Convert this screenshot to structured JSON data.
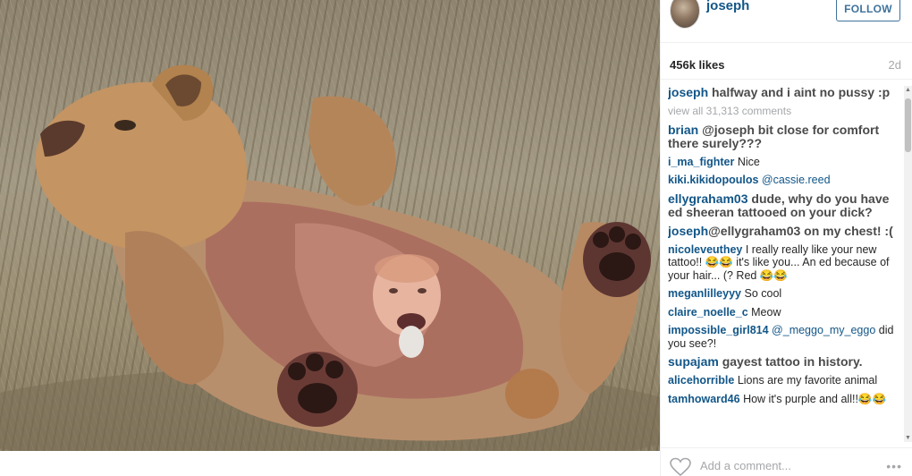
{
  "post": {
    "username": "joseph",
    "follow_label": "FOLLOW",
    "likes": "456k likes",
    "time_ago": "2d"
  },
  "comments": {
    "caption": {
      "user": "joseph",
      "text": "halfway and i aint no pussy :p"
    },
    "view_all": "view all 31,313 comments",
    "items": [
      {
        "user": "brian",
        "text": "@joseph bit close for comfort there surely???"
      },
      {
        "user": "i_ma_fighter",
        "text": "Nice"
      },
      {
        "user": "kiki.kikidopoulos",
        "mention": "@cassie.reed"
      },
      {
        "user": "ellygraham03",
        "text": "dude, why do you have ed sheeran tattooed on your dick?"
      },
      {
        "user": "joseph",
        "mention": "@ellygraham03",
        "text": "on my chest! :("
      },
      {
        "user": "nicoleveuthey",
        "text": "I really really like your new tattoo!! 😂😂 it's like you... An ed because of your hair... (? Red 😂😂"
      },
      {
        "user": "meganlilleyyy",
        "text": "So cool"
      },
      {
        "user": "claire_noelle_c",
        "text": "Meow"
      },
      {
        "user": "impossible_girl814",
        "mention": "@_meggo_my_eggo",
        "text": "did you see?!"
      },
      {
        "user": "supajam",
        "text": "gayest tattoo in history."
      },
      {
        "user": "alicehorrible",
        "text": "Lions are my favorite animal"
      },
      {
        "user": "tamhoward46",
        "text": "How it's purple and all!!😂😂"
      }
    ]
  },
  "footer": {
    "add_comment_placeholder": "Add a comment...",
    "more_label": "•••"
  },
  "icons": {
    "heart": "heart-icon",
    "more": "more-options-icon"
  },
  "colors": {
    "link_blue": "#125688",
    "follow_blue": "#3f729b",
    "muted": "#a5a7aa"
  }
}
